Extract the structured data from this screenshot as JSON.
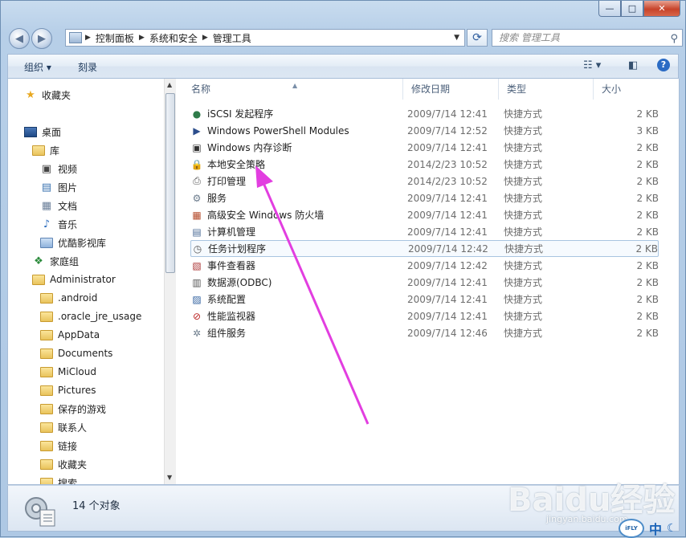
{
  "window": {
    "caption_min": "—",
    "caption_max": "□",
    "caption_close": "✕"
  },
  "address": {
    "crumbs": [
      "控制面板",
      "系统和安全",
      "管理工具"
    ]
  },
  "search": {
    "placeholder": "搜索 管理工具"
  },
  "toolbar": {
    "organize": "组织 ▾",
    "burn": "刻录"
  },
  "nav": {
    "favorites": "收藏夹",
    "desktop": "桌面",
    "library": "库",
    "video": "视频",
    "pictures": "图片",
    "documents": "文档",
    "music": "音乐",
    "youku": "优酷影视库",
    "homegroup": "家庭组",
    "user": "Administrator",
    "folders": [
      ".android",
      ".oracle_jre_usage",
      "AppData",
      "Documents",
      "MiCloud",
      "Pictures",
      "保存的游戏",
      "联系人",
      "链接",
      "收藏夹",
      "搜索"
    ]
  },
  "columns": {
    "name": "名称",
    "date": "修改日期",
    "type": "类型",
    "size": "大小"
  },
  "files": [
    {
      "name": "iSCSI 发起程序",
      "date": "2009/7/14 12:41",
      "type": "快捷方式",
      "size": "2 KB"
    },
    {
      "name": "Windows PowerShell Modules",
      "date": "2009/7/14 12:52",
      "type": "快捷方式",
      "size": "3 KB"
    },
    {
      "name": "Windows 内存诊断",
      "date": "2009/7/14 12:41",
      "type": "快捷方式",
      "size": "2 KB"
    },
    {
      "name": "本地安全策略",
      "date": "2014/2/23 10:52",
      "type": "快捷方式",
      "size": "2 KB"
    },
    {
      "name": "打印管理",
      "date": "2014/2/23 10:52",
      "type": "快捷方式",
      "size": "2 KB"
    },
    {
      "name": "服务",
      "date": "2009/7/14 12:41",
      "type": "快捷方式",
      "size": "2 KB"
    },
    {
      "name": "高级安全 Windows 防火墙",
      "date": "2009/7/14 12:41",
      "type": "快捷方式",
      "size": "2 KB"
    },
    {
      "name": "计算机管理",
      "date": "2009/7/14 12:41",
      "type": "快捷方式",
      "size": "2 KB"
    },
    {
      "name": "任务计划程序",
      "date": "2009/7/14 12:42",
      "type": "快捷方式",
      "size": "2 KB"
    },
    {
      "name": "事件查看器",
      "date": "2009/7/14 12:42",
      "type": "快捷方式",
      "size": "2 KB"
    },
    {
      "name": "数据源(ODBC)",
      "date": "2009/7/14 12:41",
      "type": "快捷方式",
      "size": "2 KB"
    },
    {
      "name": "系统配置",
      "date": "2009/7/14 12:41",
      "type": "快捷方式",
      "size": "2 KB"
    },
    {
      "name": "性能监视器",
      "date": "2009/7/14 12:41",
      "type": "快捷方式",
      "size": "2 KB"
    },
    {
      "name": "组件服务",
      "date": "2009/7/14 12:46",
      "type": "快捷方式",
      "size": "2 KB"
    }
  ],
  "status": {
    "count": "14 个对象"
  },
  "watermark": {
    "brand": "Baidu经验",
    "url": "jingyan.baidu.com"
  },
  "ime": {
    "logo": "iFLY",
    "lang": "中"
  },
  "colors": {
    "accent": "#2b5a9c",
    "annotation_arrow": "#e23ee0"
  }
}
